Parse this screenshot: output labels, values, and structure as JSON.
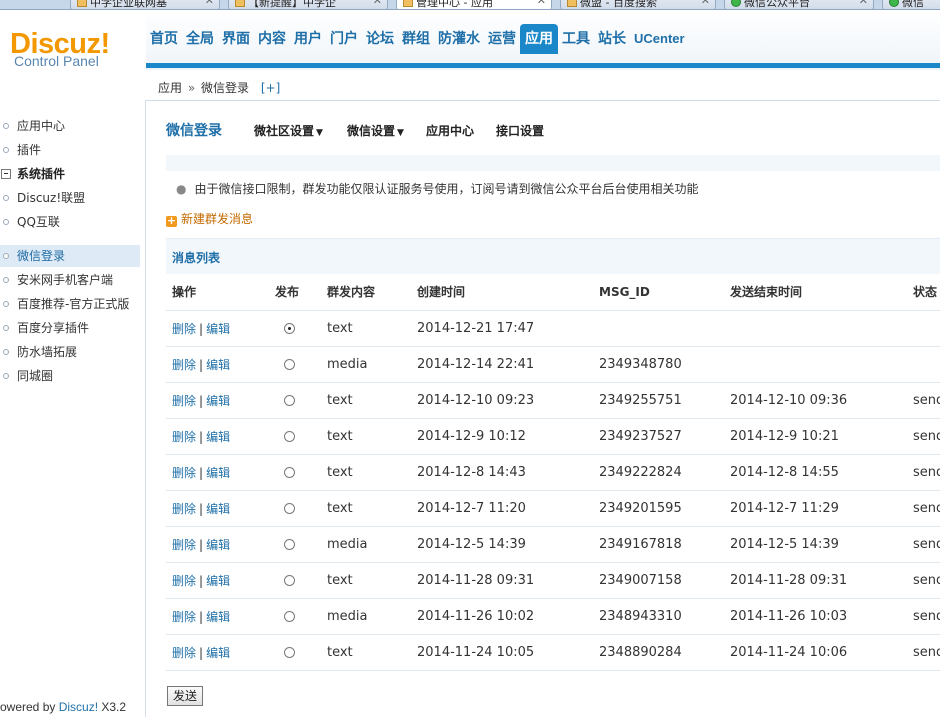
{
  "browser_tabs": [
    {
      "label": "中学企业联网基",
      "icon": "page-icon"
    },
    {
      "label": "【新提醒】中学企",
      "icon": "page-icon"
    },
    {
      "label": "管理中心 - 应用",
      "icon": "page-icon",
      "active": true
    },
    {
      "label": "微盟 - 百度搜索",
      "icon": "page-icon"
    },
    {
      "label": "微信公众平台",
      "icon": "wechat-icon"
    },
    {
      "label": "微信",
      "icon": "wechat-icon"
    }
  ],
  "logo": {
    "brand": "Discuz!",
    "subtitle": "Control Panel"
  },
  "nav": [
    "首页",
    "全局",
    "界面",
    "内容",
    "用户",
    "门户",
    "论坛",
    "群组",
    "防灌水",
    "运营",
    "应用",
    "工具",
    "站长",
    "UCenter"
  ],
  "nav_active": "应用",
  "breadcrumb": {
    "root": "应用",
    "sep": "»",
    "current": "微信登录",
    "expand": "[+]"
  },
  "sidebar": {
    "items": [
      {
        "label": "应用中心",
        "type": "item"
      },
      {
        "label": "插件",
        "type": "item"
      },
      {
        "label": "系统插件",
        "type": "group"
      },
      {
        "label": "Discuz!联盟",
        "type": "item"
      },
      {
        "label": "QQ互联",
        "type": "item"
      },
      {
        "label": "微信登录",
        "type": "item",
        "active": true
      },
      {
        "label": "安米网手机客户端",
        "type": "item"
      },
      {
        "label": "百度推荐-官方正式版",
        "type": "item"
      },
      {
        "label": "百度分享插件",
        "type": "item"
      },
      {
        "label": "防水墙拓展",
        "type": "item"
      },
      {
        "label": "同城圈",
        "type": "item"
      }
    ],
    "powered": {
      "prefix": "owered by ",
      "brand": "Discuz!",
      "version": " X3.2"
    }
  },
  "page": {
    "title": "微信登录",
    "subnav": [
      {
        "label": "微社区设置",
        "dropdown": true
      },
      {
        "label": "微信设置",
        "dropdown": true
      },
      {
        "label": "应用中心",
        "dropdown": false
      },
      {
        "label": "接口设置",
        "dropdown": false
      }
    ],
    "notice": "由于微信接口限制，群发功能仅限认证服务号使用，订阅号请到微信公众平台后台使用相关功能",
    "new_message": "新建群发消息",
    "list_title": "消息列表",
    "send_button": "发送"
  },
  "table": {
    "headers": [
      "操作",
      "发布",
      "群发内容",
      "创建时间",
      "MSG_ID",
      "发送结束时间",
      "状态"
    ],
    "delete_label": "删除",
    "edit_label": "编辑",
    "rows": [
      {
        "content": "text",
        "created": "2014-12-21 17:47",
        "msg_id": "",
        "end": "",
        "status": "",
        "selected": true
      },
      {
        "content": "media",
        "created": "2014-12-14 22:41",
        "msg_id": "2349348780",
        "end": "",
        "status": "",
        "selected": false
      },
      {
        "content": "text",
        "created": "2014-12-10 09:23",
        "msg_id": "2349255751",
        "end": "2014-12-10 09:36",
        "status": "send",
        "selected": false
      },
      {
        "content": "text",
        "created": "2014-12-9 10:12",
        "msg_id": "2349237527",
        "end": "2014-12-9 10:21",
        "status": "send",
        "selected": false
      },
      {
        "content": "text",
        "created": "2014-12-8 14:43",
        "msg_id": "2349222824",
        "end": "2014-12-8 14:55",
        "status": "send",
        "selected": false
      },
      {
        "content": "text",
        "created": "2014-12-7 11:20",
        "msg_id": "2349201595",
        "end": "2014-12-7 11:29",
        "status": "send",
        "selected": false
      },
      {
        "content": "media",
        "created": "2014-12-5 14:39",
        "msg_id": "2349167818",
        "end": "2014-12-5 14:39",
        "status": "send",
        "selected": false
      },
      {
        "content": "text",
        "created": "2014-11-28 09:31",
        "msg_id": "2349007158",
        "end": "2014-11-28 09:31",
        "status": "send",
        "selected": false
      },
      {
        "content": "media",
        "created": "2014-11-26 10:02",
        "msg_id": "2348943310",
        "end": "2014-11-26 10:03",
        "status": "send",
        "selected": false
      },
      {
        "content": "text",
        "created": "2014-11-24 10:05",
        "msg_id": "2348890284",
        "end": "2014-11-24 10:06",
        "status": "send",
        "selected": false
      }
    ]
  },
  "colors": {
    "accent": "#1a87c9",
    "link": "#1f6fa8",
    "brand": "#f39800",
    "new_message": "#c46a00"
  }
}
